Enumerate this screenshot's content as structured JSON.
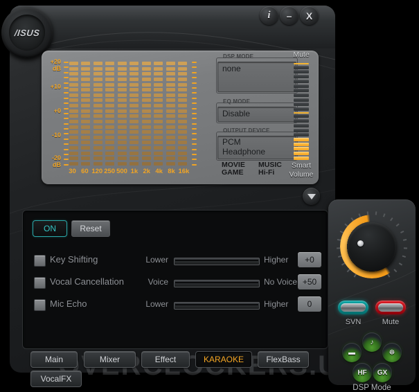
{
  "window": {
    "brand": "/ISUS",
    "buttons": [
      {
        "name": "info",
        "glyph": "i"
      },
      {
        "name": "minimize",
        "glyph": "–"
      },
      {
        "name": "close",
        "glyph": "X"
      }
    ]
  },
  "equalizer": {
    "axis_labels": [
      "+20",
      "dB",
      "+10",
      "+0",
      "-10",
      "-20",
      "dB"
    ],
    "scale_top": "+20",
    "scale_top_unit": "dB",
    "scale_mid_high": "+10",
    "scale_zero": "+0",
    "scale_mid_low": "-10",
    "scale_bottom": "-20",
    "scale_bottom_unit": "dB",
    "bands": [
      {
        "freq": "30",
        "value": 20
      },
      {
        "freq": "60",
        "value": 20
      },
      {
        "freq": "120",
        "value": 20
      },
      {
        "freq": "250",
        "value": 20
      },
      {
        "freq": "500",
        "value": 20
      },
      {
        "freq": "1k",
        "value": 20
      },
      {
        "freq": "2k",
        "value": 20
      },
      {
        "freq": "4k",
        "value": 20
      },
      {
        "freq": "8k",
        "value": 20
      },
      {
        "freq": "16k",
        "value": 20
      }
    ],
    "accent_color": "#f0a424"
  },
  "dsp_mode": {
    "legend": "DSP MODE",
    "value": "none"
  },
  "eq_mode": {
    "legend": "EQ MODE",
    "value": "Disable"
  },
  "output_device": {
    "legend": "OUTPUT DEVICE",
    "pcm": "PCM",
    "headphone": "Headphone",
    "headphone_color": "#f5a623",
    "mode_movie": "MOVIE",
    "mode_game": "GAME",
    "mode_music": "MUSIC",
    "mode_hifi": "Hi-Fi"
  },
  "volume": {
    "mute_label": "Mute",
    "smart_label_line1": "Smart",
    "smart_label_line2": "Volume",
    "segments_total": 20,
    "lit_segments": 5,
    "marker_top_index": 0,
    "marker_mid_index": 10
  },
  "collapse_button": {
    "label": "collapse"
  },
  "karaoke": {
    "power_label": "ON",
    "power_color": "#34c6c6",
    "reset_label": "Reset",
    "rows": [
      {
        "checkbox": "Key Shifting",
        "left": "Lower",
        "right": "Higher",
        "value": "+0",
        "fill": 0
      },
      {
        "checkbox": "Vocal Cancellation",
        "left": "Voice",
        "right": "No Voice",
        "value": "+50",
        "fill": 0
      },
      {
        "checkbox": "Mic Echo",
        "left": "Lower",
        "right": "Higher",
        "value": "0",
        "fill": 0
      }
    ]
  },
  "tabs": {
    "items": [
      {
        "label": "Main",
        "active": false
      },
      {
        "label": "Mixer",
        "active": false
      },
      {
        "label": "Effect",
        "active": false
      },
      {
        "label": "KARAOKE",
        "active": true
      },
      {
        "label": "FlexBass",
        "active": false
      },
      {
        "label": "VocalFX",
        "active": false
      }
    ],
    "active_color": "#f5a623"
  },
  "watermark": {
    "text": "OVERCLOCKERS.UA"
  },
  "hardware": {
    "knob": {
      "name": "volume-knob",
      "ring_color": "#f59c1a"
    },
    "leds": [
      {
        "label": "SVN",
        "color": "#0fa7a7"
      },
      {
        "label": "Mute",
        "color": "#e0202a"
      }
    ],
    "dsp_buttons": [
      {
        "name": "music",
        "glyph": "♪"
      },
      {
        "name": "movie",
        "glyph": "▬"
      },
      {
        "name": "game",
        "glyph": "☸"
      },
      {
        "name": "hf",
        "glyph": "HF"
      },
      {
        "name": "gx",
        "glyph": "GX"
      }
    ],
    "dsp_label": "DSP Mode"
  }
}
